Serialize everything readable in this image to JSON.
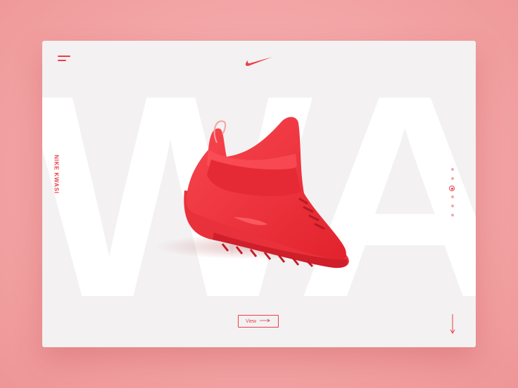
{
  "brand": {
    "name": "Nike",
    "logo_icon": "nike-swoosh-icon",
    "accent": "#ea3f4a"
  },
  "header": {
    "menu_icon": "hamburger-menu-icon"
  },
  "hero": {
    "background_text": "WA",
    "side_label": "NIKE KWASI",
    "product_image": "red-sneaker-image"
  },
  "pagination": {
    "count": 6,
    "active_index": 2
  },
  "actions": {
    "view_label": "View",
    "view_icon": "long-arrow-right-icon",
    "scroll_icon": "arrow-down-icon"
  },
  "colors": {
    "page_bg": "#f3a5a6",
    "card_bg": "#f3f1f2",
    "accent": "#ea3f4a"
  }
}
